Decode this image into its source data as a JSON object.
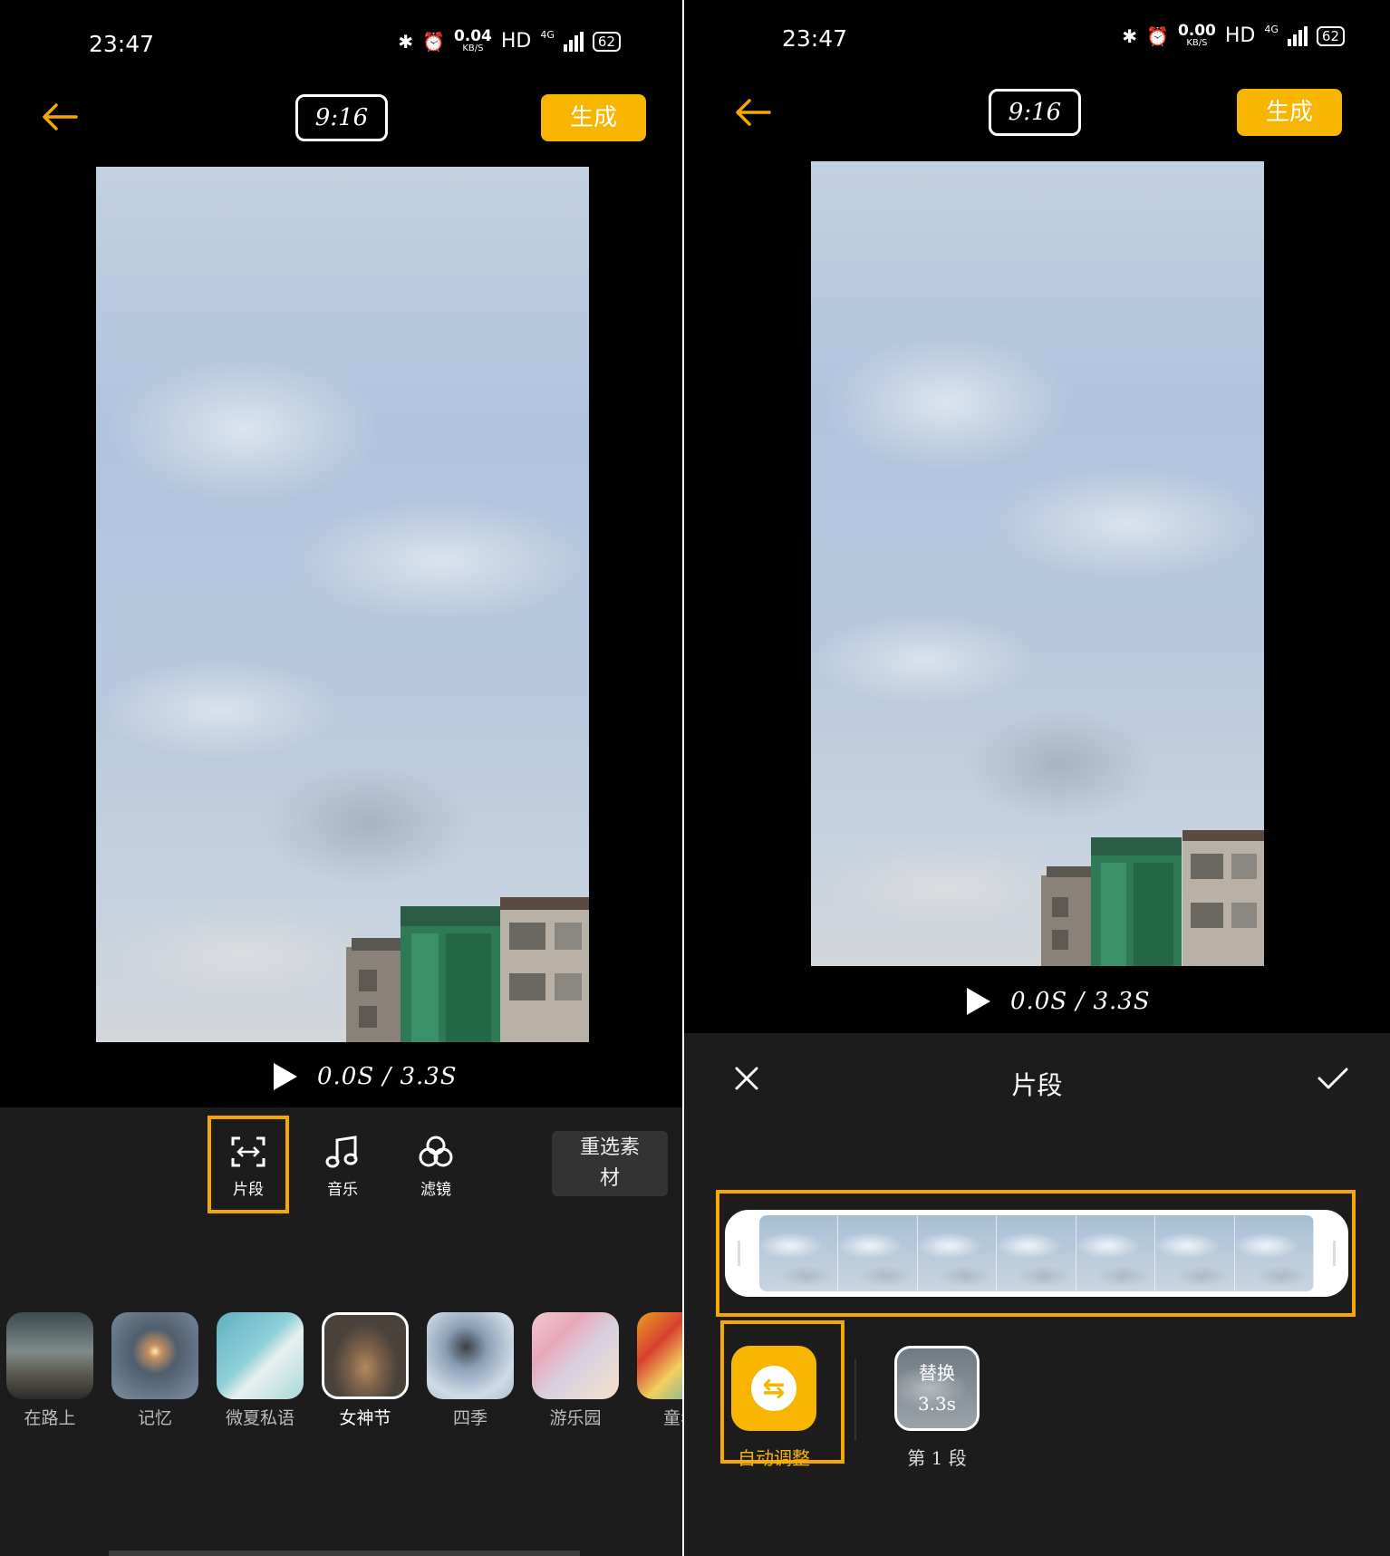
{
  "left": {
    "status": {
      "time": "23:47",
      "net_speed": "0.04",
      "net_unit": "KB/S",
      "hd": "HD",
      "network": "4G",
      "battery": "62"
    },
    "toolbar": {
      "ratio": "9:16",
      "generate_label": "生成"
    },
    "playback": {
      "time": "0.0S / 3.3S"
    },
    "tools": [
      {
        "label": "片段"
      },
      {
        "label": "音乐"
      },
      {
        "label": "滤镜"
      }
    ],
    "reselect_label_line1": "重选素",
    "reselect_label_line2": "材",
    "templates": [
      {
        "name": "在路上"
      },
      {
        "name": "记忆"
      },
      {
        "name": "微夏私语"
      },
      {
        "name": "女神节"
      },
      {
        "name": "四季"
      },
      {
        "name": "游乐园"
      },
      {
        "name": "童年"
      }
    ]
  },
  "right": {
    "status": {
      "time": "23:47",
      "net_speed": "0.00",
      "net_unit": "KB/S",
      "hd": "HD",
      "network": "4G",
      "battery": "62"
    },
    "toolbar": {
      "ratio": "9:16",
      "generate_label": "生成"
    },
    "playback": {
      "time": "0.0S / 3.3S"
    },
    "sheet_title": "片段",
    "auto_adjust_label": "自动调整",
    "segment": {
      "replace_label": "替换",
      "duration": "3.3s",
      "label": "第 1 段"
    }
  },
  "colors": {
    "accent": "#f7b500",
    "sheet_bg": "#1c1c1c",
    "highlight": "#f7a800"
  }
}
